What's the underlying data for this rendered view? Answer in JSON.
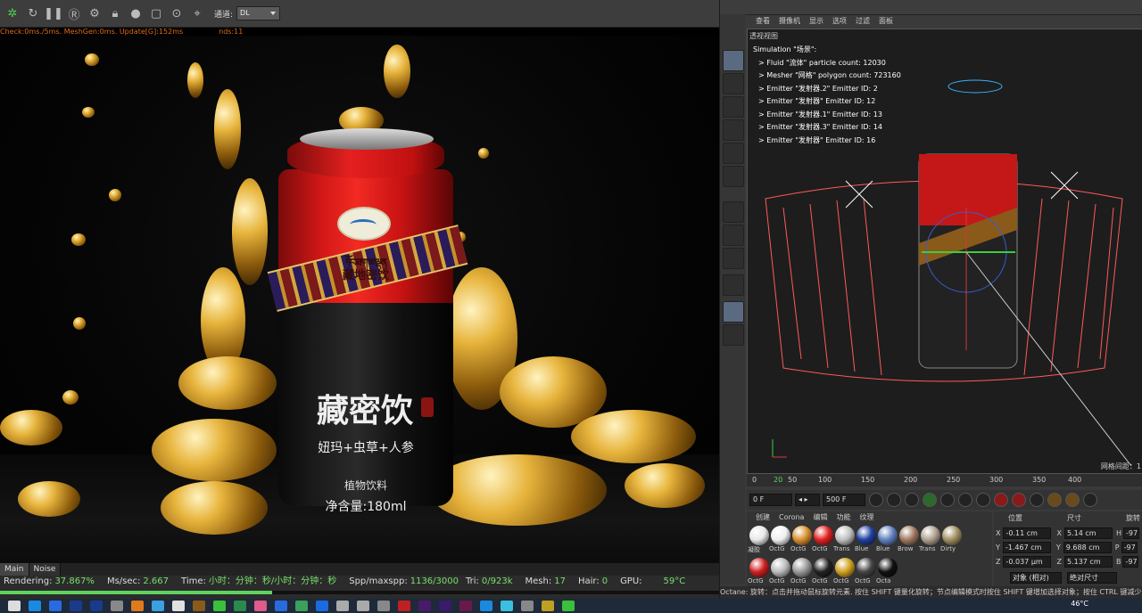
{
  "left_toolbar": {
    "channel_label": "通道:",
    "channel_value": "DL",
    "icons": [
      "refresh-green-icon",
      "reload-icon",
      "pause-icon",
      "record-icon",
      "settings-gear-icon",
      "lock-icon",
      "sphere-icon",
      "region-icon",
      "focus-pick-icon",
      "location-icon"
    ]
  },
  "stats_top": "Check:0ms./5ms. MeshGen:0ms. Update[G]:152ms",
  "stats_top_suffix": "nds:11",
  "can": {
    "tibetan_text": "ཏོང་ཐག་ཆ་ལྡན",
    "brand_red": "藏地密饮",
    "big_name": "藏密饮",
    "subtitle": "妞玛+虫草+人参",
    "kind": "植物饮料",
    "volume": "净含量:180ml"
  },
  "viewer_tabs": [
    "Main",
    "Noise"
  ],
  "render_stats": {
    "rendering_label": "Rendering:",
    "rendering_value": "37.867%",
    "progress": 0.37867,
    "mssec_label": "Ms/sec:",
    "mssec_value": "2.667",
    "time_label": "Time:",
    "time_value": "小时：分钟：秒/小时：分钟：秒",
    "spp_label": "Spp/maxspp:",
    "spp_value": "1136/3000",
    "tri_label": "Tri:",
    "tri_value": "0/923k",
    "mesh_label": "Mesh:",
    "mesh_value": "17",
    "hair_label": "Hair:",
    "hair_value": "0",
    "gpu_label": "GPU:",
    "gpu_value": "59°C"
  },
  "viewport": {
    "menu": [
      "查看",
      "摄像机",
      "显示",
      "选项",
      "过滤",
      "面板"
    ],
    "title": "透视视图",
    "sim_lines": [
      "Simulation \"场景\":",
      "> Fluid \"流体\" particle count: 12030",
      "> Mesher \"网格\" polygon count: 723160",
      "> Emitter \"发射器.2\" Emitter ID: 2",
      "> Emitter \"发射器\" Emitter ID: 12",
      "> Emitter \"发射器.1\" Emitter ID: 13",
      "> Emitter \"发射器.3\" Emitter ID: 14",
      "> Emitter \"发射器\" Emitter ID: 16"
    ],
    "grid_distance": "网格间距：1"
  },
  "timeline": {
    "ticks": [
      "0",
      "20",
      "50",
      "100",
      "150",
      "200",
      "250",
      "300",
      "350",
      "400"
    ],
    "start_frame": "0 F",
    "end_frame": "500 F"
  },
  "materials": {
    "tabs": [
      "创建",
      "Corona",
      "编辑",
      "功能",
      "纹理"
    ],
    "row1": [
      "凝胶",
      "OctG",
      "OctG",
      "OctG",
      "Trans",
      "Blue",
      "Blue",
      "Brow",
      "Trans",
      "Dirty"
    ],
    "row2": [
      "OctG",
      "OctG",
      "OctG",
      "OctG",
      "OctG",
      "OctG",
      "Octa"
    ],
    "colors1": [
      "#e8e8e8",
      "#f0f0f0",
      "#d89030",
      "#e02020",
      "#c0c0c0",
      "#2040a0",
      "#6080c0",
      "#a07860",
      "#b0a090",
      "#a09060"
    ],
    "colors2": [
      "#d02020",
      "#bbbbbb",
      "#999999",
      "#222222",
      "#d0a020",
      "#444444",
      "#111111"
    ]
  },
  "coords": {
    "pos_label": "位置",
    "size_label": "尺寸",
    "rot_label": "旋转",
    "x_pos": "-0.11 cm",
    "y_pos": "-1.467 cm",
    "z_pos": "-0.037 μm",
    "x_size": "5.14 cm",
    "y_size": "9.688 cm",
    "z_size": "5.137 cm",
    "h_rot": "-97",
    "p_rot": "-97",
    "b_rot": "-97",
    "mode_object": "对象 (相对)",
    "mode_size": "绝对尺寸"
  },
  "right_status": "Octane:   旋转：点击并拖动鼠标旋转元素. 按住 SHIFT 键量化旋转；节点编辑模式时按住 SHIFT 键增加选择对象；按住 CTRL 键减少选择对象。",
  "taskbar": {
    "clock": "46°C"
  }
}
